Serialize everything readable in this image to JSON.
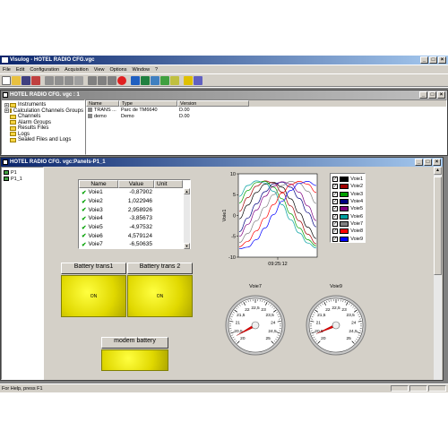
{
  "app": {
    "title": "Visulog - HOTEL RADIO CFG.vgc"
  },
  "menu": [
    "File",
    "Edit",
    "Configuration",
    "Acquisition",
    "View",
    "Options",
    "Window",
    "?"
  ],
  "config_window": {
    "title": "HOTEL RADIO CFG. vgc : 1",
    "tree": [
      {
        "label": "Instruments",
        "expand": "+"
      },
      {
        "label": "Calculation Channels Groups",
        "expand": "+"
      },
      {
        "label": "Channels",
        "expand": ""
      },
      {
        "label": "Alarm Groups",
        "expand": ""
      },
      {
        "label": "Results Files",
        "expand": ""
      },
      {
        "label": "Logs",
        "expand": ""
      },
      {
        "label": "Sealed Files and Logs",
        "expand": ""
      }
    ],
    "columns": [
      "Name",
      "Type",
      "Version"
    ],
    "rows": [
      {
        "name": "TRANS ...",
        "type": "Parc de TM6640",
        "version": "D.00"
      },
      {
        "name": "demo",
        "type": "Demo",
        "version": "D.00"
      }
    ]
  },
  "panel_window": {
    "title": "HOTEL RADIO CFG. vgc:Panels-P1_1",
    "tree": [
      "P1",
      "P1_1"
    ],
    "table": {
      "columns": [
        "Name",
        "Value",
        "Unit"
      ],
      "rows": [
        {
          "name": "Voie1",
          "value": "-0,87902"
        },
        {
          "name": "Voie2",
          "value": "1,022946"
        },
        {
          "name": "Voie3",
          "value": "2,958926"
        },
        {
          "name": "Voie4",
          "value": "-3,85673"
        },
        {
          "name": "Voie5",
          "value": "-4,97532"
        },
        {
          "name": "Voie6",
          "value": "4,579124"
        },
        {
          "name": "Voie7",
          "value": "-6,50635"
        }
      ]
    },
    "battery_buttons": [
      {
        "label": "Battery trans1",
        "state": "ON"
      },
      {
        "label": "Battery trans 2",
        "state": "ON"
      }
    ],
    "modem": {
      "label": "modem battery"
    },
    "gauges": [
      {
        "title": "Voie7",
        "ticks": [
          "20",
          "20,5",
          "21",
          "21,5",
          "22",
          "22,5",
          "23",
          "23,5",
          "24",
          "24,5",
          "25"
        ],
        "value": 20.3
      },
      {
        "title": "Voie9",
        "ticks": [
          "20",
          "20,5",
          "21",
          "21,5",
          "22",
          "22,5",
          "23",
          "23,5",
          "24",
          "24,5",
          "25"
        ],
        "value": 20.4
      }
    ]
  },
  "chart_data": {
    "type": "line",
    "ylabel": "Voie1",
    "xlabel": "09:25:12",
    "ylim": [
      -10,
      10
    ],
    "yticks": [
      "10",
      "5",
      "0",
      "-5",
      "-10"
    ],
    "series": [
      {
        "name": "Voie1",
        "color": "#000000",
        "values": [
          -0.8,
          2.5,
          5.5,
          7.5,
          8,
          6.8,
          4,
          0.6,
          -2.8,
          -5.5
        ]
      },
      {
        "name": "Voie2",
        "color": "#a00000",
        "values": [
          1.0,
          4.3,
          7,
          8.3,
          7.8,
          5.6,
          2.3,
          -1.3,
          -4.5,
          -6.8
        ]
      },
      {
        "name": "Voie3",
        "color": "#00a000",
        "values": [
          3.0,
          6,
          7.9,
          8.2,
          6.8,
          4,
          0.4,
          -3,
          -5.8,
          -7.3
        ]
      },
      {
        "name": "Voie4",
        "color": "#000080",
        "values": [
          -3.9,
          -0.6,
          2.8,
          5.7,
          7.6,
          8,
          6.8,
          4.1,
          0.7,
          -2.7
        ]
      },
      {
        "name": "Voie5",
        "color": "#800080",
        "values": [
          -5.0,
          -2.1,
          1.3,
          4.6,
          7,
          8.1,
          7.6,
          5.6,
          2.3,
          -1.2
        ]
      },
      {
        "name": "Voie6",
        "color": "#00a0a0",
        "values": [
          4.6,
          7.2,
          8.3,
          7.8,
          5.8,
          2.6,
          -1,
          -4.2,
          -6.6,
          -7.8
        ]
      },
      {
        "name": "Voie7",
        "color": "#808080",
        "values": [
          -6.5,
          -4.3,
          -1.3,
          2,
          5,
          7.2,
          8.2,
          7.7,
          5.8,
          2.9
        ]
      },
      {
        "name": "Voie8",
        "color": "#ff0000",
        "values": [
          -7.5,
          -6.2,
          -3.7,
          -0.6,
          2.6,
          5.4,
          7.4,
          8.2,
          7.5,
          5.5
        ]
      },
      {
        "name": "Voie9",
        "color": "#0000ff",
        "values": [
          -8,
          -7.6,
          -5.8,
          -3,
          0.2,
          3.4,
          6,
          7.7,
          8.2,
          7.2
        ]
      }
    ]
  },
  "status": {
    "text": "For Help, press F1"
  }
}
